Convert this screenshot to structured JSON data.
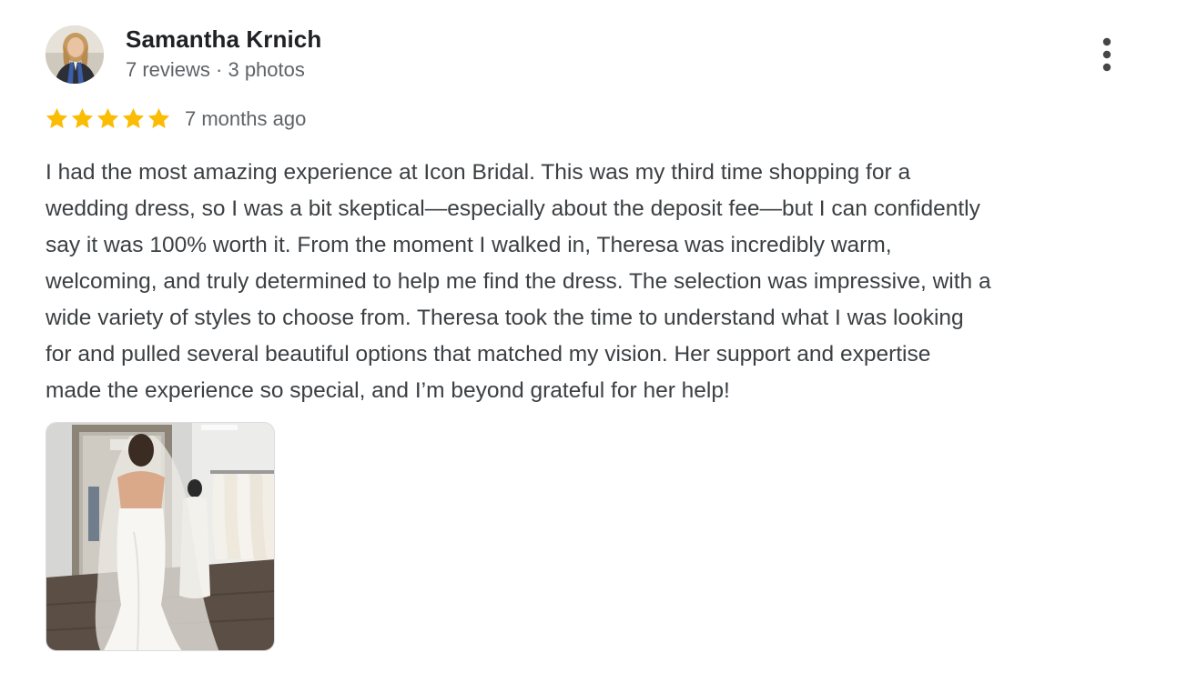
{
  "reviewer": {
    "name": "Samantha Krnich",
    "meta": "7 reviews · 3 photos"
  },
  "rating": {
    "stars": 5,
    "max": 5,
    "star_color": "#fbbc04",
    "time": "7 months ago"
  },
  "review": {
    "lines": [
      "I had the most amazing experience at Icon Bridal. This was my third time shopping for a",
      "wedding dress, so I was a bit skeptical—especially about the deposit fee—but I can confidently",
      "say it was 100% worth it. From the moment I walked in, Theresa was incredibly warm,",
      "welcoming, and truly determined to help me find the dress. The selection was impressive, with a",
      "wide variety of styles to choose from. Theresa took the time to understand what I was looking",
      "for and pulled several beautiful options that matched my vision. Her support and expertise",
      "made the experience so special, and I’m beyond grateful for her help!"
    ]
  },
  "icons": {
    "more": "more-vert-icon",
    "star": "star-icon"
  },
  "colors": {
    "name": "#202124",
    "text": "#3c4043",
    "meta": "#5f6368"
  }
}
